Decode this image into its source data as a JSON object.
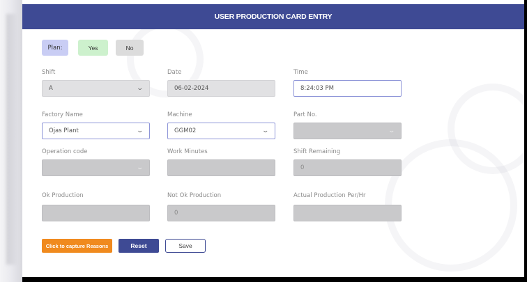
{
  "header": {
    "title": "USER PRODUCTION CARD ENTRY"
  },
  "plan": {
    "label": "Plan:",
    "yes": "Yes",
    "no": "No"
  },
  "fields": {
    "shift": {
      "label": "Shift",
      "value": "A"
    },
    "date": {
      "label": "Date",
      "value": "06-02-2024"
    },
    "time": {
      "label": "Time",
      "value": "8:24:03 PM"
    },
    "factory_name": {
      "label": "Factory Name",
      "value": "Ojas Plant"
    },
    "machine": {
      "label": "Machine",
      "value": "GGM02"
    },
    "part_no": {
      "label": "Part No.",
      "value": ""
    },
    "operation_code": {
      "label": "Operation code",
      "value": ""
    },
    "work_minutes": {
      "label": "Work Minutes",
      "value": ""
    },
    "shift_remaining": {
      "label": "Shift Remaining",
      "value": "0"
    },
    "ok_production": {
      "label": "Ok Production",
      "value": ""
    },
    "not_ok_production": {
      "label": "Not Ok Production",
      "value": "0"
    },
    "actual_production": {
      "label": "Actual Production Per/Hr",
      "value": ""
    }
  },
  "buttons": {
    "capture": "Click to capture Reasons",
    "reset": "Reset",
    "save": "Save"
  },
  "colors": {
    "header_bg": "#3e4a94",
    "capture_btn": "#f08a1e",
    "yes_btn": "#cdf1cd",
    "plan_label": "#c9cdf4"
  }
}
